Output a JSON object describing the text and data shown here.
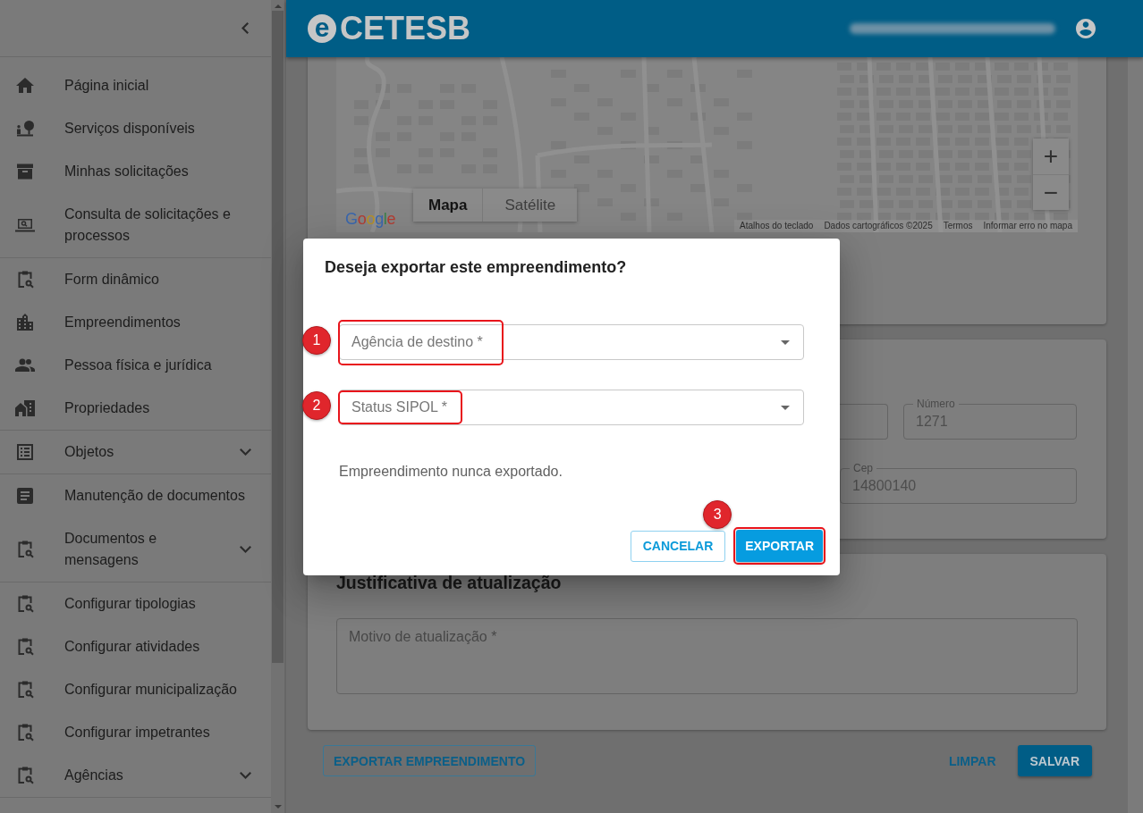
{
  "sidebar": {
    "groups": [
      {
        "items": [
          {
            "label": "Página inicial",
            "expandable": false
          },
          {
            "label": "Serviços disponíveis",
            "expandable": false
          },
          {
            "label": "Minhas solicitações",
            "expandable": false
          },
          {
            "label": "Consulta de solicitações e processos",
            "expandable": false
          }
        ]
      },
      {
        "items": [
          {
            "label": "Form dinâmico",
            "expandable": false
          },
          {
            "label": "Empreendimentos",
            "expandable": false
          },
          {
            "label": "Pessoa física e jurídica",
            "expandable": false
          },
          {
            "label": "Propriedades",
            "expandable": false
          }
        ]
      },
      {
        "items": [
          {
            "label": "Objetos",
            "expandable": true
          }
        ]
      },
      {
        "items": [
          {
            "label": "Manutenção de documentos",
            "expandable": false
          },
          {
            "label": "Documentos e mensagens",
            "expandable": true
          }
        ]
      },
      {
        "items": [
          {
            "label": "Configurar tipologias",
            "expandable": false
          },
          {
            "label": "Configurar atividades",
            "expandable": false
          },
          {
            "label": "Configurar municipalização",
            "expandable": false
          },
          {
            "label": "Configurar impetrantes",
            "expandable": false
          },
          {
            "label": "Agências",
            "expandable": true
          }
        ]
      }
    ]
  },
  "header": {
    "logo_mark": "e",
    "logo_text": "CETESB"
  },
  "map": {
    "type_buttons": [
      {
        "label": "Mapa",
        "selected": true
      },
      {
        "label": "Satélite",
        "selected": false
      }
    ],
    "zoom_controls": [
      "+",
      "−"
    ],
    "provider_logo": "Google",
    "attribution": [
      "Atalhos do teclado",
      "Dados cartográficos ©2025",
      "Termos",
      "Informar erro no mapa"
    ]
  },
  "address_card": {
    "rows": [
      {
        "fields": [
          {
            "kind": "partial"
          },
          {
            "kind": "outlined",
            "label": "Número",
            "value": "1271"
          }
        ]
      },
      {
        "fields": [
          {
            "kind": "outlined",
            "label": "Cep",
            "value": "14800140"
          }
        ]
      }
    ]
  },
  "justification_card": {
    "title": "Justificativa de atualização",
    "textarea": {
      "placeholder": "Motivo de atualização *"
    }
  },
  "actions": {
    "left": [
      {
        "label": "EXPORTAR EMPREENDIMENTO",
        "kind": "outlined"
      }
    ],
    "right": [
      {
        "label": "LIMPAR",
        "kind": "text"
      },
      {
        "label": "SALVAR",
        "kind": "filled"
      }
    ]
  },
  "dialog": {
    "title": "Deseja exportar este empreendimento?",
    "fields": [
      {
        "placeholder": "Agência de destino *",
        "highlighted": true,
        "step": "1"
      },
      {
        "placeholder": "Status SIPOL *",
        "highlighted": true,
        "step": "2"
      }
    ],
    "message": "Empreendimento nunca exportado.",
    "buttons": [
      {
        "label": "CANCELAR",
        "kind": "outlined",
        "highlighted": false
      },
      {
        "label": "EXPORTAR",
        "kind": "primary",
        "highlighted": true,
        "step": "3"
      }
    ]
  }
}
